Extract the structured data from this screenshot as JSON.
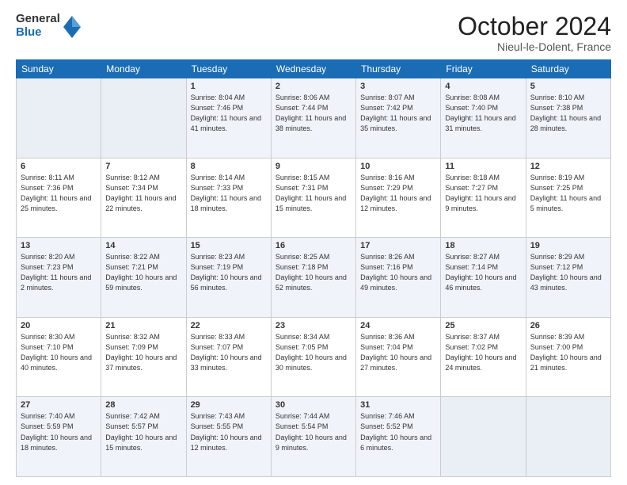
{
  "header": {
    "logo_general": "General",
    "logo_blue": "Blue",
    "month_title": "October 2024",
    "location": "Nieul-le-Dolent, France"
  },
  "weekdays": [
    "Sunday",
    "Monday",
    "Tuesday",
    "Wednesday",
    "Thursday",
    "Friday",
    "Saturday"
  ],
  "rows": [
    [
      {
        "day": "",
        "text": ""
      },
      {
        "day": "",
        "text": ""
      },
      {
        "day": "1",
        "text": "Sunrise: 8:04 AM\nSunset: 7:46 PM\nDaylight: 11 hours and 41 minutes."
      },
      {
        "day": "2",
        "text": "Sunrise: 8:06 AM\nSunset: 7:44 PM\nDaylight: 11 hours and 38 minutes."
      },
      {
        "day": "3",
        "text": "Sunrise: 8:07 AM\nSunset: 7:42 PM\nDaylight: 11 hours and 35 minutes."
      },
      {
        "day": "4",
        "text": "Sunrise: 8:08 AM\nSunset: 7:40 PM\nDaylight: 11 hours and 31 minutes."
      },
      {
        "day": "5",
        "text": "Sunrise: 8:10 AM\nSunset: 7:38 PM\nDaylight: 11 hours and 28 minutes."
      }
    ],
    [
      {
        "day": "6",
        "text": "Sunrise: 8:11 AM\nSunset: 7:36 PM\nDaylight: 11 hours and 25 minutes."
      },
      {
        "day": "7",
        "text": "Sunrise: 8:12 AM\nSunset: 7:34 PM\nDaylight: 11 hours and 22 minutes."
      },
      {
        "day": "8",
        "text": "Sunrise: 8:14 AM\nSunset: 7:33 PM\nDaylight: 11 hours and 18 minutes."
      },
      {
        "day": "9",
        "text": "Sunrise: 8:15 AM\nSunset: 7:31 PM\nDaylight: 11 hours and 15 minutes."
      },
      {
        "day": "10",
        "text": "Sunrise: 8:16 AM\nSunset: 7:29 PM\nDaylight: 11 hours and 12 minutes."
      },
      {
        "day": "11",
        "text": "Sunrise: 8:18 AM\nSunset: 7:27 PM\nDaylight: 11 hours and 9 minutes."
      },
      {
        "day": "12",
        "text": "Sunrise: 8:19 AM\nSunset: 7:25 PM\nDaylight: 11 hours and 5 minutes."
      }
    ],
    [
      {
        "day": "13",
        "text": "Sunrise: 8:20 AM\nSunset: 7:23 PM\nDaylight: 11 hours and 2 minutes."
      },
      {
        "day": "14",
        "text": "Sunrise: 8:22 AM\nSunset: 7:21 PM\nDaylight: 10 hours and 59 minutes."
      },
      {
        "day": "15",
        "text": "Sunrise: 8:23 AM\nSunset: 7:19 PM\nDaylight: 10 hours and 56 minutes."
      },
      {
        "day": "16",
        "text": "Sunrise: 8:25 AM\nSunset: 7:18 PM\nDaylight: 10 hours and 52 minutes."
      },
      {
        "day": "17",
        "text": "Sunrise: 8:26 AM\nSunset: 7:16 PM\nDaylight: 10 hours and 49 minutes."
      },
      {
        "day": "18",
        "text": "Sunrise: 8:27 AM\nSunset: 7:14 PM\nDaylight: 10 hours and 46 minutes."
      },
      {
        "day": "19",
        "text": "Sunrise: 8:29 AM\nSunset: 7:12 PM\nDaylight: 10 hours and 43 minutes."
      }
    ],
    [
      {
        "day": "20",
        "text": "Sunrise: 8:30 AM\nSunset: 7:10 PM\nDaylight: 10 hours and 40 minutes."
      },
      {
        "day": "21",
        "text": "Sunrise: 8:32 AM\nSunset: 7:09 PM\nDaylight: 10 hours and 37 minutes."
      },
      {
        "day": "22",
        "text": "Sunrise: 8:33 AM\nSunset: 7:07 PM\nDaylight: 10 hours and 33 minutes."
      },
      {
        "day": "23",
        "text": "Sunrise: 8:34 AM\nSunset: 7:05 PM\nDaylight: 10 hours and 30 minutes."
      },
      {
        "day": "24",
        "text": "Sunrise: 8:36 AM\nSunset: 7:04 PM\nDaylight: 10 hours and 27 minutes."
      },
      {
        "day": "25",
        "text": "Sunrise: 8:37 AM\nSunset: 7:02 PM\nDaylight: 10 hours and 24 minutes."
      },
      {
        "day": "26",
        "text": "Sunrise: 8:39 AM\nSunset: 7:00 PM\nDaylight: 10 hours and 21 minutes."
      }
    ],
    [
      {
        "day": "27",
        "text": "Sunrise: 7:40 AM\nSunset: 5:59 PM\nDaylight: 10 hours and 18 minutes."
      },
      {
        "day": "28",
        "text": "Sunrise: 7:42 AM\nSunset: 5:57 PM\nDaylight: 10 hours and 15 minutes."
      },
      {
        "day": "29",
        "text": "Sunrise: 7:43 AM\nSunset: 5:55 PM\nDaylight: 10 hours and 12 minutes."
      },
      {
        "day": "30",
        "text": "Sunrise: 7:44 AM\nSunset: 5:54 PM\nDaylight: 10 hours and 9 minutes."
      },
      {
        "day": "31",
        "text": "Sunrise: 7:46 AM\nSunset: 5:52 PM\nDaylight: 10 hours and 6 minutes."
      },
      {
        "day": "",
        "text": ""
      },
      {
        "day": "",
        "text": ""
      }
    ]
  ]
}
